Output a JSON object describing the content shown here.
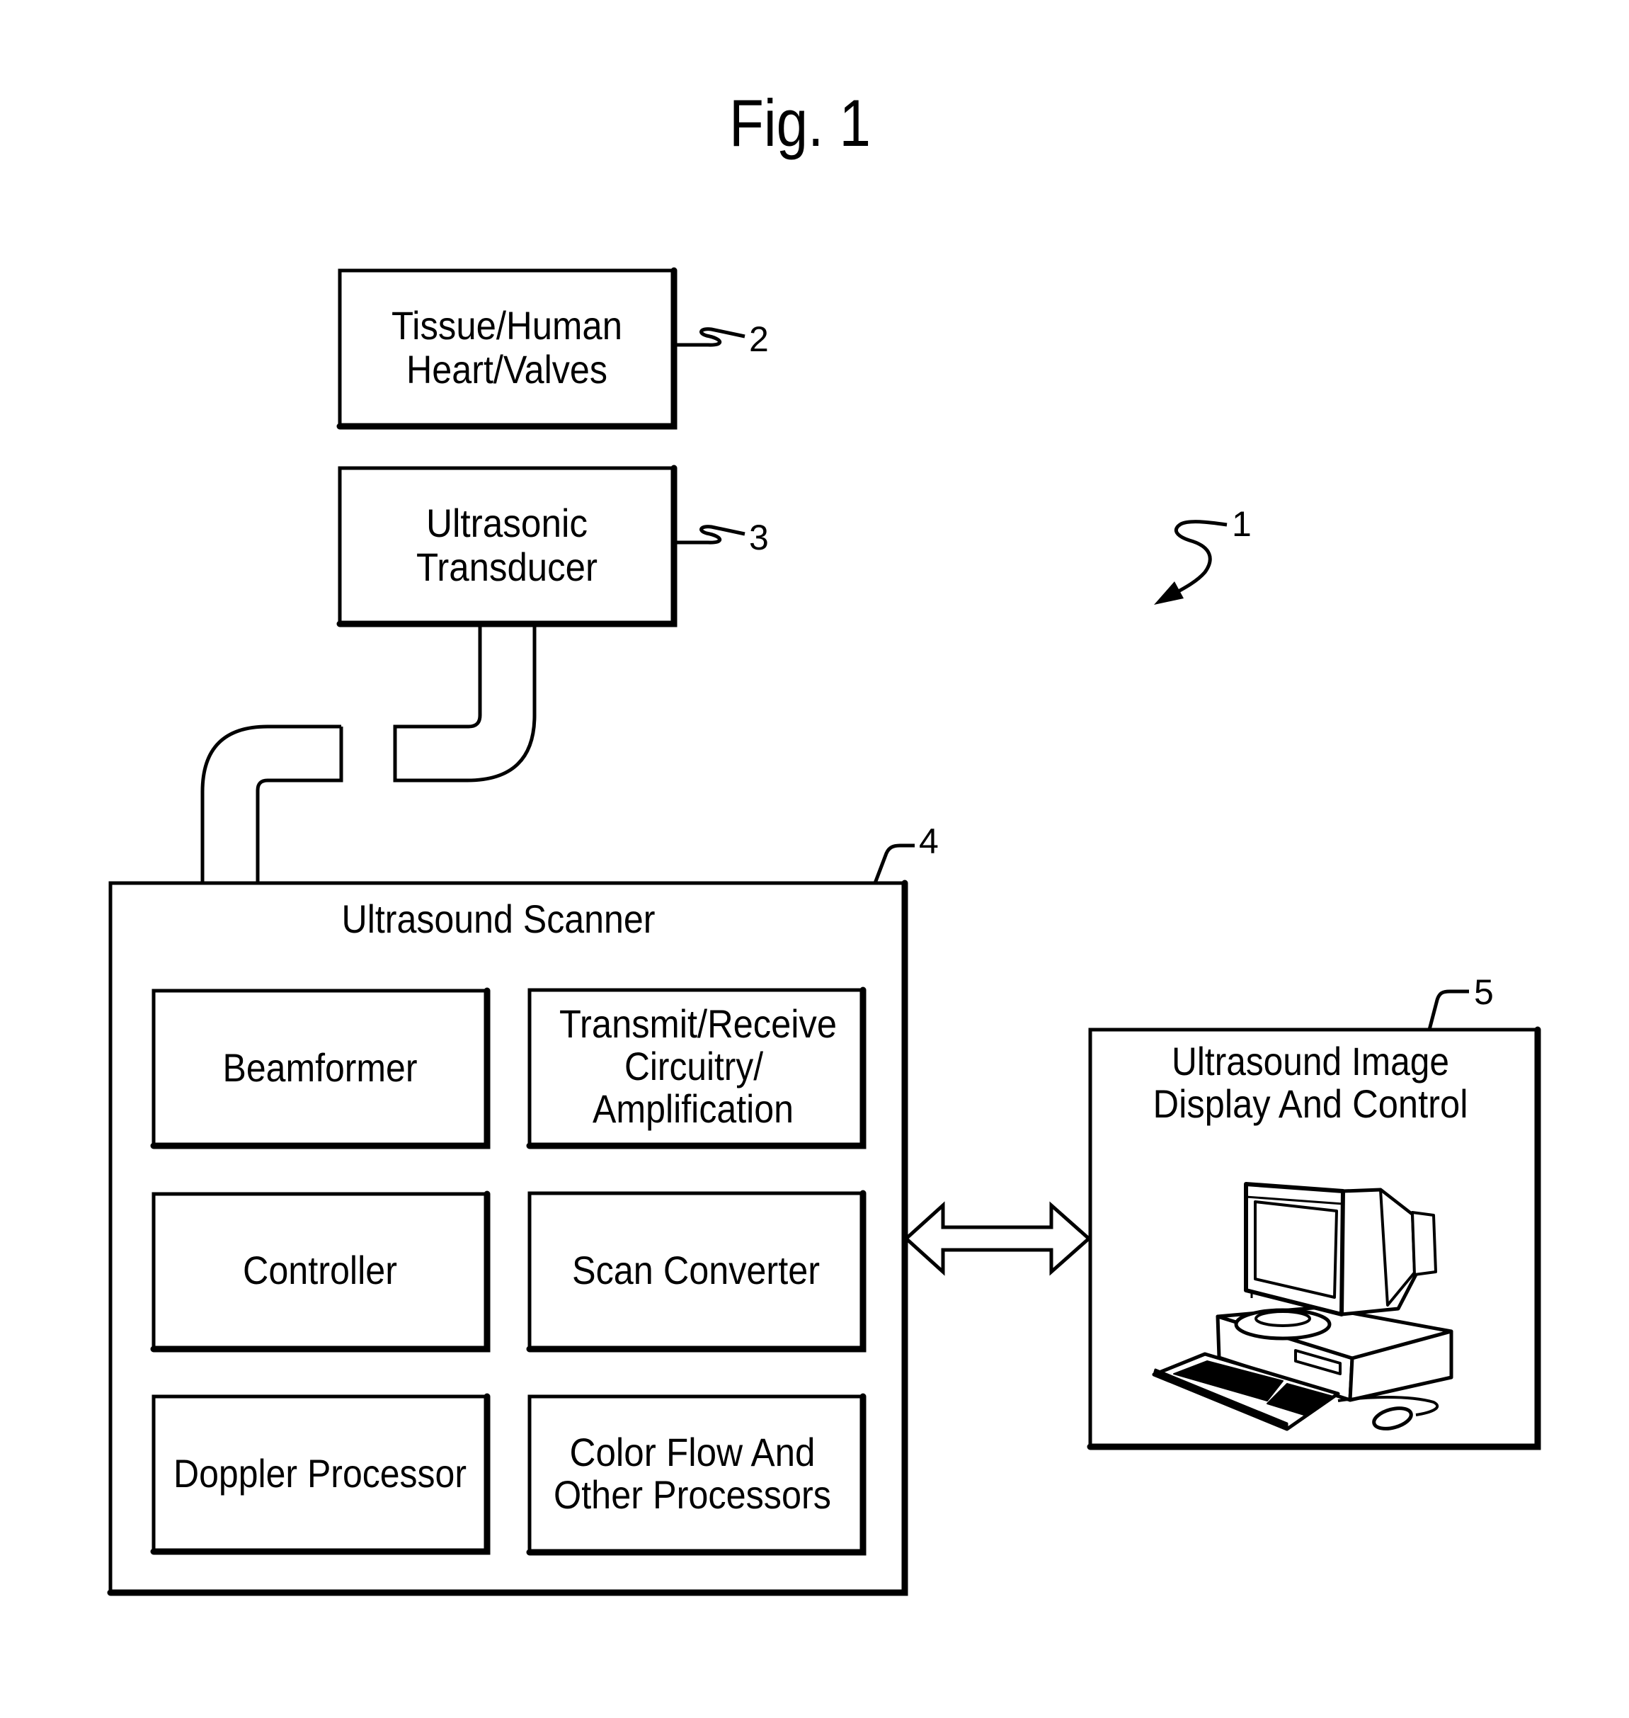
{
  "figure": {
    "title": "Fig. 1",
    "system_ref": "1"
  },
  "blocks": {
    "tissue": {
      "ref": "2",
      "lines": [
        "Tissue/Human",
        "Heart/Valves"
      ]
    },
    "transducer": {
      "ref": "3",
      "lines": [
        "Ultrasonic",
        "Transducer"
      ]
    },
    "scanner": {
      "ref": "4",
      "title": "Ultrasound Scanner",
      "modules": [
        {
          "lines": [
            "Beamformer"
          ]
        },
        {
          "lines": [
            "Transmit/Receive",
            "Circuitry/",
            "Amplification"
          ]
        },
        {
          "lines": [
            "Controller"
          ]
        },
        {
          "lines": [
            "Scan Converter"
          ]
        },
        {
          "lines": [
            "Doppler Processor"
          ]
        },
        {
          "lines": [
            "Color Flow And",
            "Other Processors"
          ]
        }
      ]
    },
    "display": {
      "ref": "5",
      "lines": [
        "Ultrasound Image",
        "Display And Control"
      ],
      "illustration": "desktop-computer-icon"
    }
  },
  "connections": [
    {
      "from": "transducer",
      "to": "scanner",
      "type": "cable"
    },
    {
      "from": "scanner",
      "to": "display",
      "type": "bidirectional-arrow"
    }
  ]
}
